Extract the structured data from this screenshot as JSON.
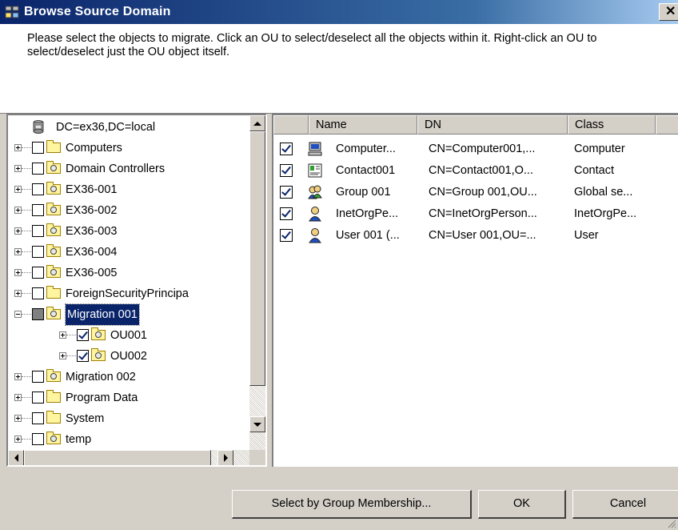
{
  "window": {
    "title": "Browse Source Domain",
    "close_glyph": "✕",
    "title_icon": "directory-browse-icon"
  },
  "header": {
    "instructions": "Please select the objects to migrate. Click an OU to select/deselect all the objects within it. Right-click an OU to select/deselect just the OU object itself."
  },
  "tree": {
    "root": {
      "label": "DC=ex36,DC=local",
      "icon": "domain-icon"
    },
    "items": [
      {
        "label": "Computers",
        "icon": "folder-icon",
        "checked": "unchecked",
        "level": 1
      },
      {
        "label": "Domain Controllers",
        "icon": "ou-icon",
        "checked": "unchecked",
        "level": 1
      },
      {
        "label": "EX36-001",
        "icon": "ou-icon",
        "checked": "unchecked",
        "level": 1
      },
      {
        "label": "EX36-002",
        "icon": "ou-icon",
        "checked": "unchecked",
        "level": 1
      },
      {
        "label": "EX36-003",
        "icon": "ou-icon",
        "checked": "unchecked",
        "level": 1
      },
      {
        "label": "EX36-004",
        "icon": "ou-icon",
        "checked": "unchecked",
        "level": 1
      },
      {
        "label": "EX36-005",
        "icon": "ou-icon",
        "checked": "unchecked",
        "level": 1
      },
      {
        "label": "ForeignSecurityPrincipa",
        "icon": "folder-icon",
        "checked": "unchecked",
        "level": 1
      },
      {
        "label": "Migration 001",
        "icon": "ou-icon",
        "checked": "partial",
        "level": 1,
        "expanded": true,
        "selected": true
      },
      {
        "label": "OU001",
        "icon": "ou-icon",
        "checked": "checked",
        "level": 2
      },
      {
        "label": "OU002",
        "icon": "ou-icon",
        "checked": "checked",
        "level": 2
      },
      {
        "label": "Migration 002",
        "icon": "ou-icon",
        "checked": "unchecked",
        "level": 1
      },
      {
        "label": "Program Data",
        "icon": "folder-icon",
        "checked": "unchecked",
        "level": 1
      },
      {
        "label": "System",
        "icon": "folder-icon",
        "checked": "unchecked",
        "level": 1
      },
      {
        "label": "temp",
        "icon": "ou-icon",
        "checked": "unchecked",
        "level": 1
      }
    ]
  },
  "list": {
    "columns": [
      "Name",
      "DN",
      "Class"
    ],
    "rows": [
      {
        "name": "Computer...",
        "dn": "CN=Computer001,...",
        "class": "Computer",
        "icon": "computer-icon",
        "checked": true
      },
      {
        "name": "Contact001",
        "dn": "CN=Contact001,O...",
        "class": "Contact",
        "icon": "contact-icon",
        "checked": true
      },
      {
        "name": "Group 001",
        "dn": "CN=Group 001,OU...",
        "class": "Global se...",
        "icon": "group-icon",
        "checked": true
      },
      {
        "name": "InetOrgPe...",
        "dn": "CN=InetOrgPerson...",
        "class": "InetOrgPe...",
        "icon": "user-icon",
        "checked": true
      },
      {
        "name": "User 001 (...",
        "dn": "CN=User 001,OU=...",
        "class": "User",
        "icon": "user-icon",
        "checked": true
      }
    ]
  },
  "buttons": {
    "group_membership": "Select by Group Membership...",
    "ok": "OK",
    "cancel": "Cancel"
  },
  "colors": {
    "titlebar": "#0a246a",
    "dialog_face": "#d4d0c8",
    "selection": "#0a246a",
    "checkmark": "#0a246a"
  }
}
